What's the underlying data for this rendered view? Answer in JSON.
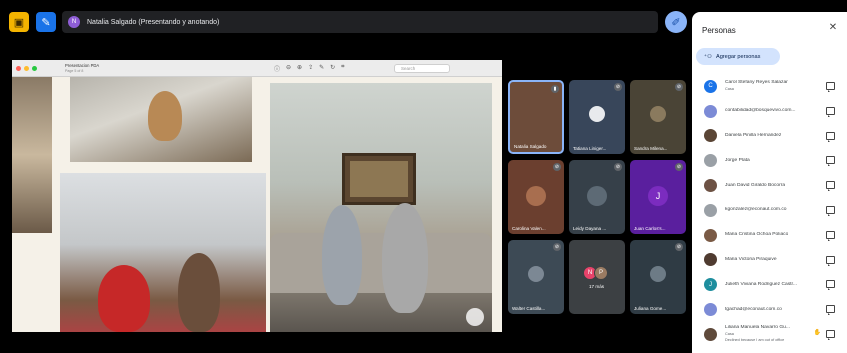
{
  "presenter": {
    "initial": "N",
    "label": "Natalia Salgado (Presentando y anotando)"
  },
  "viewer": {
    "title": "Presentacion PDA",
    "subtitle": "Page 5 of 8",
    "search_placeholder": "Search"
  },
  "tiles": [
    {
      "name": "Natalia Salgado",
      "initial": "",
      "color": "#6d4c3a"
    },
    {
      "name": "Tatiana Liniger...",
      "initial": "",
      "color": "#38465a"
    },
    {
      "name": "Sandra Milena...",
      "initial": "",
      "color": "#4a4436"
    },
    {
      "name": "Carolina Valen...",
      "initial": "",
      "color": "#6b3f2f"
    },
    {
      "name": "Leidy Dayana ...",
      "initial": "",
      "color": "#364049"
    },
    {
      "name": "Juan Carlos's...",
      "initial": "J",
      "color": "#7b2cbf"
    },
    {
      "name": "Walter Castilla...",
      "initial": "",
      "color": "#3d4a55"
    },
    {
      "name": "17 más",
      "initial": "",
      "color": "#3c4043"
    },
    {
      "name": "Juliana Gome...",
      "initial": "",
      "color": "#2f3b44"
    }
  ],
  "more_avatars": [
    "N",
    "P"
  ],
  "panel": {
    "title": "Personas",
    "add_label": "Agregar personas",
    "people": [
      {
        "name": "Carol Stefany Reyes Salazar",
        "sub": "Casa",
        "initial": "C",
        "color": "#1a73e8"
      },
      {
        "name": "contabilidad@bosquevivo.com...",
        "sub": "",
        "initial": "",
        "color": "#7c8bd6"
      },
      {
        "name": "Daniela Pinilla Hernandez",
        "sub": "",
        "initial": "",
        "color": "#5a4535"
      },
      {
        "name": "Jorge Plata",
        "sub": "",
        "initial": "",
        "color": "#9aa0a6"
      },
      {
        "name": "Juan David Giraldo Bocorra",
        "sub": "",
        "initial": "",
        "color": "#6d5244"
      },
      {
        "name": "kgonzalez@econaut.com.co",
        "sub": "",
        "initial": "",
        "color": "#9aa0a6"
      },
      {
        "name": "Maria Cristina Ochoa Poliaco",
        "sub": "",
        "initial": "",
        "color": "#7a5a45"
      },
      {
        "name": "Maria Victoria Piraquive",
        "sub": "",
        "initial": "",
        "color": "#4f3b30"
      },
      {
        "name": "Julieth Viviana Rodriguez Castr...",
        "sub": "",
        "initial": "J",
        "color": "#1e8e9e"
      },
      {
        "name": "tgachad@econaut.com.co",
        "sub": "",
        "initial": "",
        "color": "#7c8bd6"
      },
      {
        "name": "Liliana Manuela Navarro Gu...",
        "sub": "Casa",
        "note": "Declined because I am out of office",
        "initial": "",
        "color": "#5f4a3b",
        "hand": true
      }
    ]
  },
  "icons": {
    "close": "✕",
    "add_person": "person-add-icon",
    "hand": "✋"
  }
}
